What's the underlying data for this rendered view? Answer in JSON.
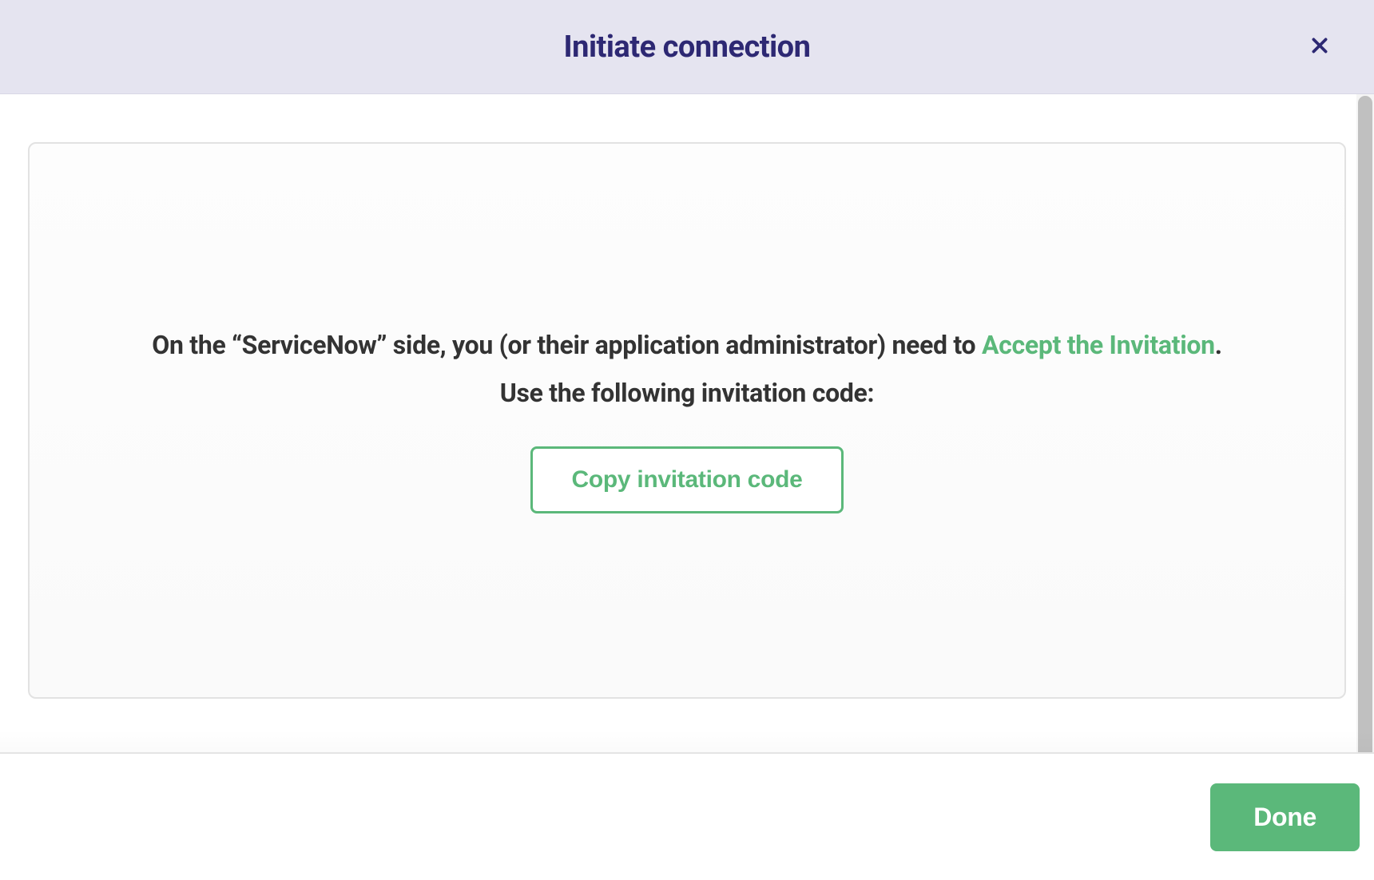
{
  "modal": {
    "title": "Initiate connection",
    "instruction_prefix": "On the “ServiceNow” side, you (or their application administrator) need to ",
    "instruction_link": "Accept the Invitation",
    "instruction_suffix": ".",
    "subline": "Use the following invitation code:",
    "copy_button_label": "Copy invitation code",
    "done_button_label": "Done"
  }
}
